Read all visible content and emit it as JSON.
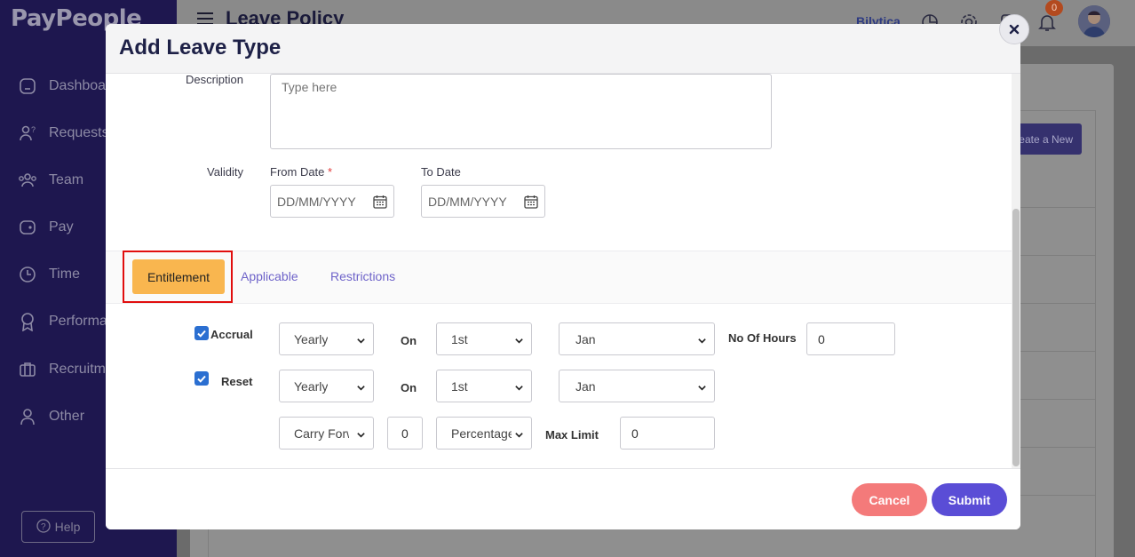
{
  "app": {
    "brand": "PayPeople",
    "page_title": "Leave Policy",
    "company": "Bilytica",
    "notification_count": "0",
    "create_button": "Create a New",
    "help_label": "Help"
  },
  "sidebar": {
    "items": [
      {
        "label": "Dashboard",
        "icon": "home-icon"
      },
      {
        "label": "Requests",
        "icon": "user-request-icon"
      },
      {
        "label": "Team",
        "icon": "team-icon"
      },
      {
        "label": "Pay",
        "icon": "wallet-icon"
      },
      {
        "label": "Time",
        "icon": "clock-icon"
      },
      {
        "label": "Performance",
        "icon": "award-icon"
      },
      {
        "label": "Recruitment",
        "icon": "briefcase-icon"
      },
      {
        "label": "Other",
        "icon": "person-icon"
      }
    ]
  },
  "modal": {
    "title": "Add Leave Type",
    "description_label": "Description",
    "description_placeholder": "Type here",
    "validity_label": "Validity",
    "from_date_label": "From Date",
    "required_mark": "*",
    "to_date_label": "To Date",
    "date_placeholder": "DD/MM/YYYY",
    "tabs": [
      "Entitlement",
      "Applicable",
      "Restrictions"
    ],
    "active_tab": "Entitlement",
    "accrual": {
      "label": "Accrual",
      "checked": true,
      "frequency": "Yearly",
      "on_label": "On",
      "day": "1st",
      "month": "Jan",
      "hours_label": "No Of Hours",
      "hours_value": "0"
    },
    "reset": {
      "label": "Reset",
      "checked": true,
      "frequency": "Yearly",
      "on_label": "On",
      "day": "1st",
      "month": "Jan"
    },
    "carry": {
      "type": "Carry Forward",
      "value": "0",
      "unit": "Percentage",
      "max_label": "Max Limit",
      "max_value": "0"
    },
    "cancel_label": "Cancel",
    "submit_label": "Submit"
  },
  "colors": {
    "sidebar": "#1e174f",
    "tab_active": "#f9b64f",
    "tab_link": "#6e63c9",
    "cancel": "#f47a7a",
    "submit": "#5a4dd6",
    "highlight": "#e10e0e"
  }
}
